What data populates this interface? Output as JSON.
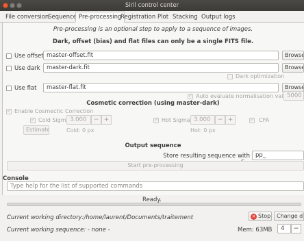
{
  "window": {
    "title": "Siril control center"
  },
  "tabs": [
    "File conversion",
    "Sequence",
    "Pre-processing",
    "Registration",
    "Plot",
    "Stacking",
    "Output logs"
  ],
  "preproc": {
    "intro": "Pre-processing is an optional step to apply to a sequence of images.",
    "heading": "Dark, offset (bias) and flat files can only be a single FITS file.",
    "offset": {
      "label": "Use offset",
      "file": "master-offset.fit",
      "browse": "Browse"
    },
    "dark": {
      "label": "Use dark",
      "file": "master-dark.fit",
      "browse": "Browse",
      "optimization": "Dark optimization"
    },
    "flat": {
      "label": "Use flat",
      "file": "master-flat.fit",
      "browse": "Browse",
      "auto_eval": "Auto evaluate normalisation value",
      "norm_value": "5000"
    },
    "cosmetic": {
      "title": "Cosmetic correction (using master-dark)",
      "enable": "Enable Cosmectic Correction",
      "cold_label": "Cold Sigma:",
      "cold_value": "3.000",
      "hot_label": "Hot Sigma:",
      "hot_value": "3.000",
      "cfa": "CFA",
      "estimate": "Estimate",
      "cold_px": "Cold: 0 px",
      "hot_px": "Hot: 0 px",
      "minus": "−",
      "plus": "+"
    },
    "output": {
      "title": "Output sequence",
      "prefix_label": "Store resulting sequence with prefix:",
      "prefix_value": "pp_",
      "start": "Start pre-processing"
    }
  },
  "console": {
    "label": "Console",
    "placeholder": "Type help for the list of supported commands",
    "status": "Ready.",
    "progress": 0
  },
  "footer": {
    "cwd_label": "Current working directory:",
    "cwd_value": "/home/laurent/Documents/traitement",
    "stop": "Stop",
    "change_dir": "Change di",
    "seq_label": "Current working sequence:",
    "seq_value": " - none -",
    "mem": "Mem: 63MB",
    "threads": "4",
    "threads_minus": "−"
  }
}
